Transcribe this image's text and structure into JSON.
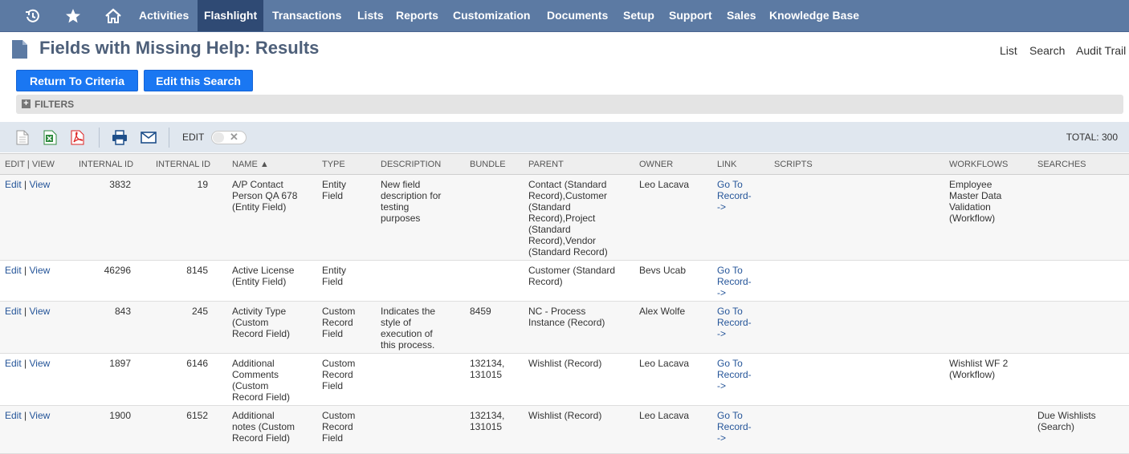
{
  "nav": {
    "items": [
      "Activities",
      "Flashlight",
      "Transactions",
      "Lists",
      "Reports",
      "Customization",
      "Documents",
      "Setup",
      "Support",
      "Sales",
      "Knowledge Base"
    ],
    "active": "Flashlight",
    "icons": [
      "recent-records-icon",
      "star-icon",
      "home-icon"
    ]
  },
  "page": {
    "title": "Fields with Missing Help: Results",
    "links": [
      "List",
      "Search",
      "Audit Trail"
    ]
  },
  "buttons": {
    "return_label": "Return To Criteria",
    "edit_search_label": "Edit this Search"
  },
  "filters": {
    "label": "FILTERS",
    "expand_symbol": "+"
  },
  "toolbar": {
    "icons": [
      "export-csv-icon",
      "export-excel-icon",
      "export-pdf-icon",
      "print-icon",
      "email-icon"
    ],
    "edit_label": "EDIT",
    "edit_toggle_on": false,
    "total": "TOTAL: 300"
  },
  "table": {
    "columns": [
      "EDIT | VIEW",
      "INTERNAL ID",
      "INTERNAL ID",
      "NAME ▲",
      "TYPE",
      "DESCRIPTION",
      "BUNDLE",
      "PARENT",
      "OWNER",
      "LINK",
      "SCRIPTS",
      "WORKFLOWS",
      "SEARCHES"
    ],
    "edit_text": "Edit",
    "view_text": "View",
    "separator": "|",
    "rows": [
      {
        "id1": "3832",
        "id2": "19",
        "name": "A/P Contact\nPerson QA 678\n(Entity Field)",
        "type": "Entity\nField",
        "description": "New field\ndescription for\ntesting\npurposes",
        "bundle": "",
        "parent": "Contact (Standard\nRecord),Customer\n(Standard\nRecord),Project\n(Standard\nRecord),Vendor\n(Standard Record)",
        "owner": "Leo Lacava",
        "link": "Go To\nRecord-\n->",
        "scripts": "",
        "workflows": "Employee\nMaster Data\nValidation\n(Workflow)",
        "searches": ""
      },
      {
        "id1": "46296",
        "id2": "8145",
        "name": "Active License\n(Entity Field)",
        "type": "Entity\nField",
        "description": "",
        "bundle": "",
        "parent": "Customer (Standard\nRecord)",
        "owner": "Bevs Ucab",
        "link": "Go To\nRecord-\n->",
        "scripts": "",
        "workflows": "",
        "searches": ""
      },
      {
        "id1": "843",
        "id2": "245",
        "name": "Activity Type\n(Custom\nRecord Field)",
        "type": "Custom\nRecord\nField",
        "description": "Indicates the\nstyle of\nexecution of\nthis process.",
        "bundle": "8459",
        "parent": "NC - Process\nInstance (Record)",
        "owner": "Alex Wolfe",
        "link": "Go To\nRecord-\n->",
        "scripts": "",
        "workflows": "",
        "searches": ""
      },
      {
        "id1": "1897",
        "id2": "6146",
        "name": "Additional\nComments\n(Custom\nRecord Field)",
        "type": "Custom\nRecord\nField",
        "description": "",
        "bundle": "132134,\n131015",
        "parent": "Wishlist (Record)",
        "owner": "Leo Lacava",
        "link": "Go To\nRecord-\n->",
        "scripts": "",
        "workflows": "Wishlist WF 2\n(Workflow)",
        "searches": ""
      },
      {
        "id1": "1900",
        "id2": "6152",
        "name": "Additional\nnotes (Custom\nRecord Field)",
        "type": "Custom\nRecord\nField",
        "description": "",
        "bundle": "132134,\n131015",
        "parent": "Wishlist (Record)",
        "owner": "Leo Lacava",
        "link": "Go To\nRecord-\n->",
        "scripts": "",
        "workflows": "",
        "searches": "Due Wishlists\n(Search)"
      }
    ]
  },
  "colors": {
    "nav_bg": "#5c7aa3",
    "nav_active": "#2f4a74",
    "button": "#1a77f2",
    "link": "#255599",
    "title": "#4d5f79"
  }
}
